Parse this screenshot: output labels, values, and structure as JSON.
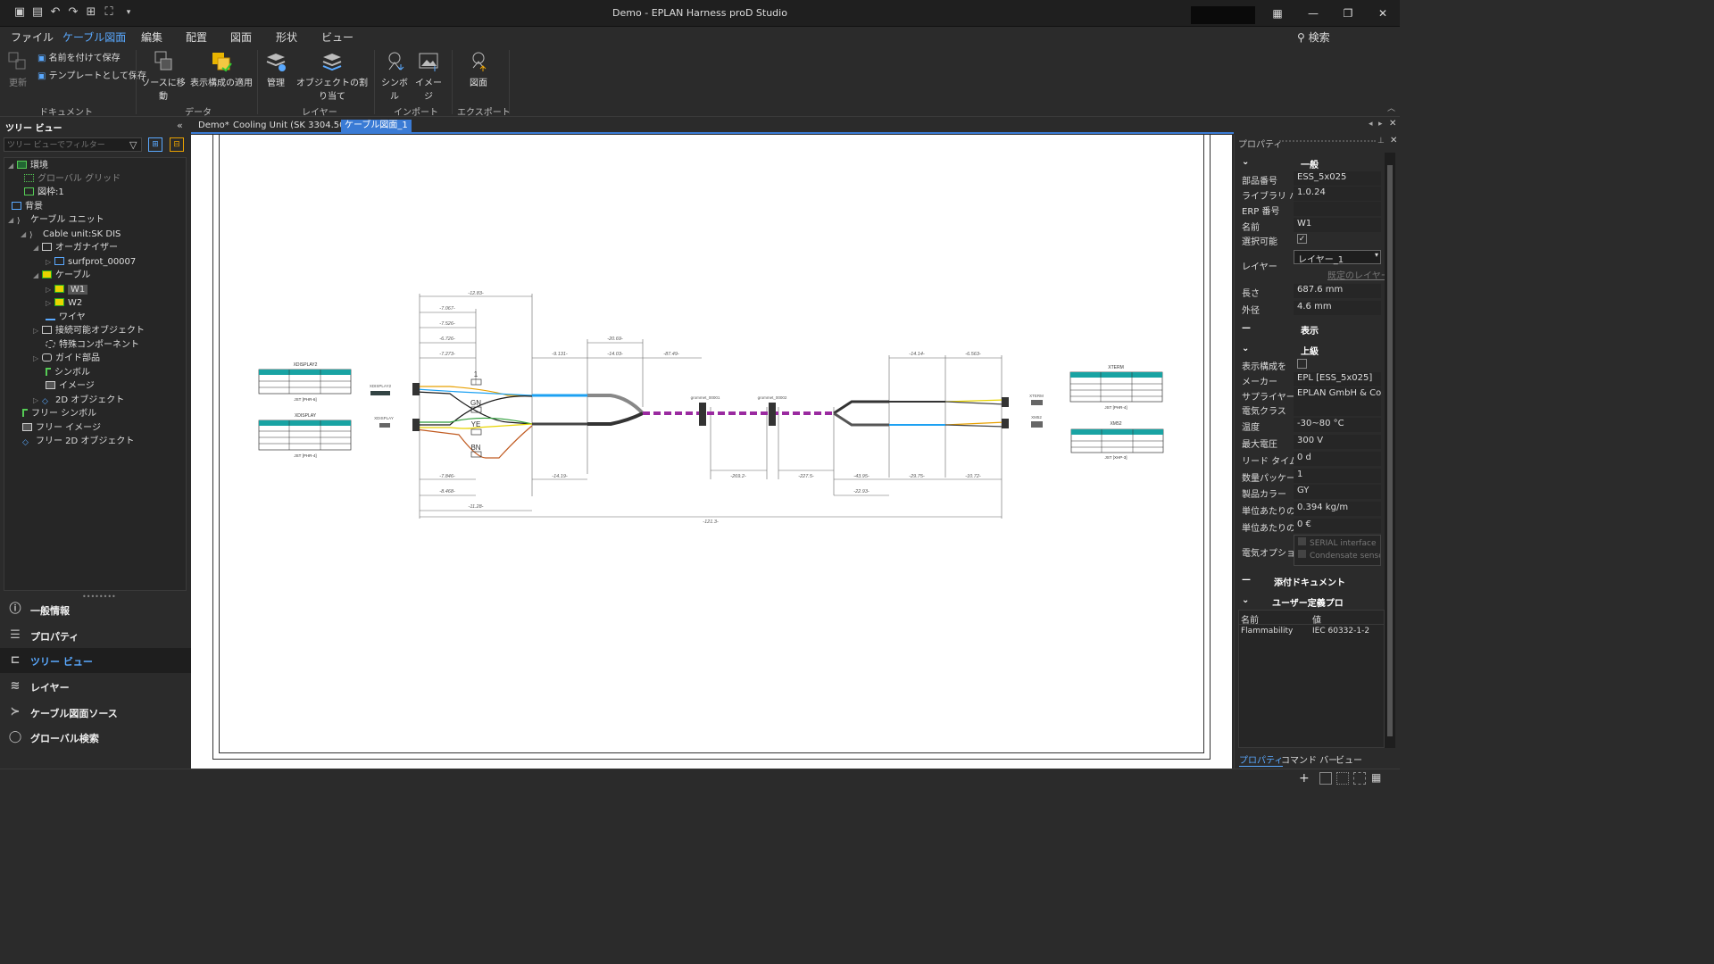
{
  "window": {
    "title": "Demo - EPLAN Harness proD Studio"
  },
  "menu": [
    "ファイル",
    "ケーブル図面",
    "編集",
    "配置",
    "図面",
    "形状",
    "ビュー"
  ],
  "search_label": "検索",
  "ribbon": {
    "update": "更新",
    "save_as": "名前を付けて保存",
    "save_template": "テンプレートとして保存",
    "go_source": "ソースに移動",
    "apply_config": "表示構成の適用",
    "manage": "管理",
    "assign_object": "オブジェクトの割り当て",
    "symbol": "シンボル",
    "image": "イメージ",
    "drawing": "図面",
    "groups": [
      "ドキュメント",
      "データ",
      "レイヤー",
      "インポート",
      "エクスポート"
    ]
  },
  "left": {
    "header": "ツリー ビュー",
    "filter_placeholder": "ツリー ビューでフィルター",
    "tree": [
      {
        "label": "環境"
      },
      {
        "label": "グローバル グリッド"
      },
      {
        "label": "図枠:1"
      },
      {
        "label": "背景"
      },
      {
        "label": "ケーブル ユニット"
      },
      {
        "label": "Cable unit:SK DIS"
      },
      {
        "label": "オーガナイザー"
      },
      {
        "label": "surfprot_00007"
      },
      {
        "label": "ケーブル"
      },
      {
        "label": "W1"
      },
      {
        "label": "W2"
      },
      {
        "label": "ワイヤ"
      },
      {
        "label": "接続可能オブジェクト"
      },
      {
        "label": "特殊コンポーネント"
      },
      {
        "label": "ガイド部品"
      },
      {
        "label": "シンボル"
      },
      {
        "label": "イメージ"
      },
      {
        "label": "2D オブジェクト"
      },
      {
        "label": "フリー シンボル"
      },
      {
        "label": "フリー イメージ"
      },
      {
        "label": "フリー 2D オブジェクト"
      }
    ],
    "nav": [
      "一般情報",
      "プロパティ",
      "ツリー ビュー",
      "レイヤー",
      "ケーブル図面ソース",
      "グローバル検索"
    ]
  },
  "tabs": [
    "Demo*",
    "Cooling Unit (SK 3304.500)*",
    "ケーブル図面_1"
  ],
  "props": {
    "header": "プロパティ",
    "sections": {
      "general": "一般",
      "display": "表示",
      "advanced": "上級",
      "attach": "添付ドキュメント",
      "user": "ユーザー定義プロパティ"
    },
    "general": {
      "part_no": {
        "k": "部品番号",
        "v": "ESS_5x025"
      },
      "lib_ver": {
        "k": "ライブラリ バー",
        "v": "1.0.24"
      },
      "erp": {
        "k": "ERP 番号",
        "v": ""
      },
      "name": {
        "k": "名前",
        "v": "W1"
      },
      "selectable": {
        "k": "選択可能",
        "v": "✓"
      },
      "layer": {
        "k": "レイヤー",
        "v": "レイヤー_1"
      },
      "default_layer": "既定のレイヤー",
      "length": {
        "k": "長さ",
        "v": "687.6 mm"
      },
      "outer_dia": {
        "k": "外径",
        "v": "4.6 mm"
      }
    },
    "advanced": {
      "display_cfg": {
        "k": "表示構成を"
      },
      "maker": {
        "k": "メーカー",
        "v": "EPL [ESS_5x025]"
      },
      "supplier": {
        "k": "サプライヤー",
        "v": "EPLAN GmbH & Co. K"
      },
      "elec_class": {
        "k": "電気クラス",
        "v": ""
      },
      "temp": {
        "k": "温度",
        "v": "-30~80 °C"
      },
      "max_voltage": {
        "k": "最大電圧",
        "v": "300 V"
      },
      "lead_time": {
        "k": "リード タイム",
        "v": "0 d"
      },
      "qty_pack": {
        "k": "数量パッケー",
        "v": "1"
      },
      "color": {
        "k": "製品カラー",
        "v": "GY"
      },
      "unit_weight": {
        "k": "単位あたりの",
        "v": "0.394 kg/m"
      },
      "unit_price": {
        "k": "単位あたりの",
        "v": "0 €"
      },
      "elec_option": {
        "k": "電気オプショ",
        "opts": [
          "SERIAL interface",
          "Condensate sensor"
        ]
      }
    },
    "user_table": {
      "h1": "名前",
      "h2": "値",
      "rows": [
        {
          "n": "Flammability",
          "v": "IEC 60332-1-2"
        }
      ]
    }
  },
  "bottom_tabs": [
    "プロパティ",
    "コマンド バー",
    "ビュー"
  ],
  "drawing": {
    "left_tables": [
      "XDISPLAY2",
      "XDISPLAY"
    ],
    "left_footers": [
      "JST [PHR-6]",
      "JST [PHR-4]"
    ],
    "right_tables": [
      "XTERM",
      "XM52"
    ],
    "right_footers": [
      "JST [PHR-4]",
      "JST [XHP-3]"
    ],
    "plug_labels": [
      "XDISPLAY2",
      "XDISPLAY",
      "XTERM",
      "XM52"
    ],
    "grommets": [
      "grommet_00001",
      "grommet_00002"
    ],
    "wire_labels": [
      "1",
      "GN",
      "YE",
      "BN"
    ],
    "dims_top": [
      "-12.83-",
      "-7.067-",
      "-7.526-",
      "-6.726-",
      "-7.273-",
      "-9.131-",
      "-20.69-",
      "-14.03-",
      "-87.49-",
      "-14.14-",
      "-6.563-"
    ],
    "dims_bottom": [
      "-7.846-",
      "-8.468-",
      "-11.28-",
      "-14.19-",
      "-269.2-",
      "-227.5-",
      "-43.95-",
      "-22.93-",
      "-29.75-",
      "-10.72-",
      "-121.3-"
    ],
    "table_header": "コンタクト番号 ワイヤ番号 ピン番号",
    "rows_a": [
      [
        "1",
        "1",
        "1"
      ],
      [
        "2",
        "2",
        "2"
      ],
      [
        "3",
        "Shield 1",
        "3"
      ]
    ],
    "rows_b": [
      [
        "1",
        "WH",
        "1"
      ],
      [
        "2",
        "BN",
        "2"
      ],
      [
        "3",
        "GN",
        "3"
      ],
      [
        "4",
        "YE",
        "4"
      ]
    ]
  }
}
